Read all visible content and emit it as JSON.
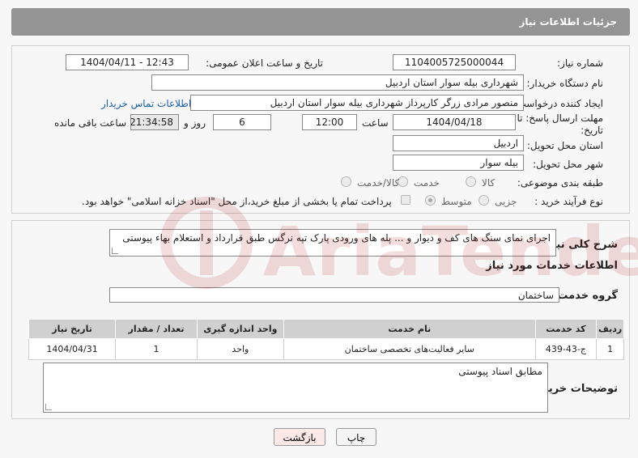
{
  "header": {
    "title": "جزئیات اطلاعات نیاز"
  },
  "form": {
    "need_number_label": "شماره نیاز:",
    "need_number": "1104005725000044",
    "announce_label": "تاریخ و ساعت اعلان عمومی:",
    "announce_value": "1404/04/11 - 12:43",
    "buyer_org_label": "نام دستگاه خریدار:",
    "buyer_org": "شهرداری بیله سوار استان اردبیل",
    "creator_label": "ایجاد کننده درخواست:",
    "creator": "منصور مرادی زرگر کارپرداز شهرداری بیله سوار استان اردبیل",
    "contact_link": "اطلاعات تماس خریدار",
    "deadline_label_1": "مهلت ارسال پاسخ: تا",
    "deadline_label_2": "تاریخ:",
    "deadline_date": "1404/04/18",
    "time_label": "ساعت",
    "deadline_time": "12:00",
    "days_value": "6",
    "days_label": "روز و",
    "remaining_time": "21:34:58",
    "remaining_label": "ساعت باقی مانده",
    "province_label": "استان محل تحویل:",
    "province": "اردبیل",
    "city_label": "شهر محل تحویل:",
    "city": "بیله سوار",
    "category_label": "طبقه بندی موضوعی:",
    "category_options": [
      "کالا",
      "خدمت",
      "کالا/خدمت"
    ],
    "process_label": "نوع فرآیند خرید :",
    "process_options": [
      "جزیی",
      "متوسط"
    ],
    "payment_note": "پرداخت تمام یا بخشی از مبلغ خرید،از محل \"اسناد خزانه اسلامی\" خواهد بود."
  },
  "details": {
    "summary_label": "شرح کلی نیاز:",
    "summary": "اجرای نمای سنگ های کف و دیوار و ... پله های ورودی پارک تپه نرگس طبق قرارداد و استعلام بهاء پیوستی",
    "services_title": "اطلاعات خدمات مورد نیاز",
    "service_group_label": "گروه خدمت:",
    "service_group": "ساختمان",
    "table": {
      "headers": [
        "ردیف",
        "کد خدمت",
        "نام خدمت",
        "واحد اندازه گیری",
        "تعداد / مقدار",
        "تاریخ نیاز"
      ],
      "rows": [
        [
          "1",
          "ج-43-439",
          "سایر فعالیت‌های تخصصی ساختمان",
          "واحد",
          "1",
          "1404/04/31"
        ]
      ]
    },
    "buyer_notes_label": "توضیحات خریدار:",
    "buyer_notes": "مطابق اسناد پیوستی"
  },
  "buttons": {
    "print": "چاپ",
    "back": "بازگشت"
  },
  "watermark": {
    "text": "AriaTender.net"
  },
  "colors": {
    "header_bg": "#949494",
    "link": "#1b5fb0",
    "back_button_bg": "#fde8e8"
  }
}
